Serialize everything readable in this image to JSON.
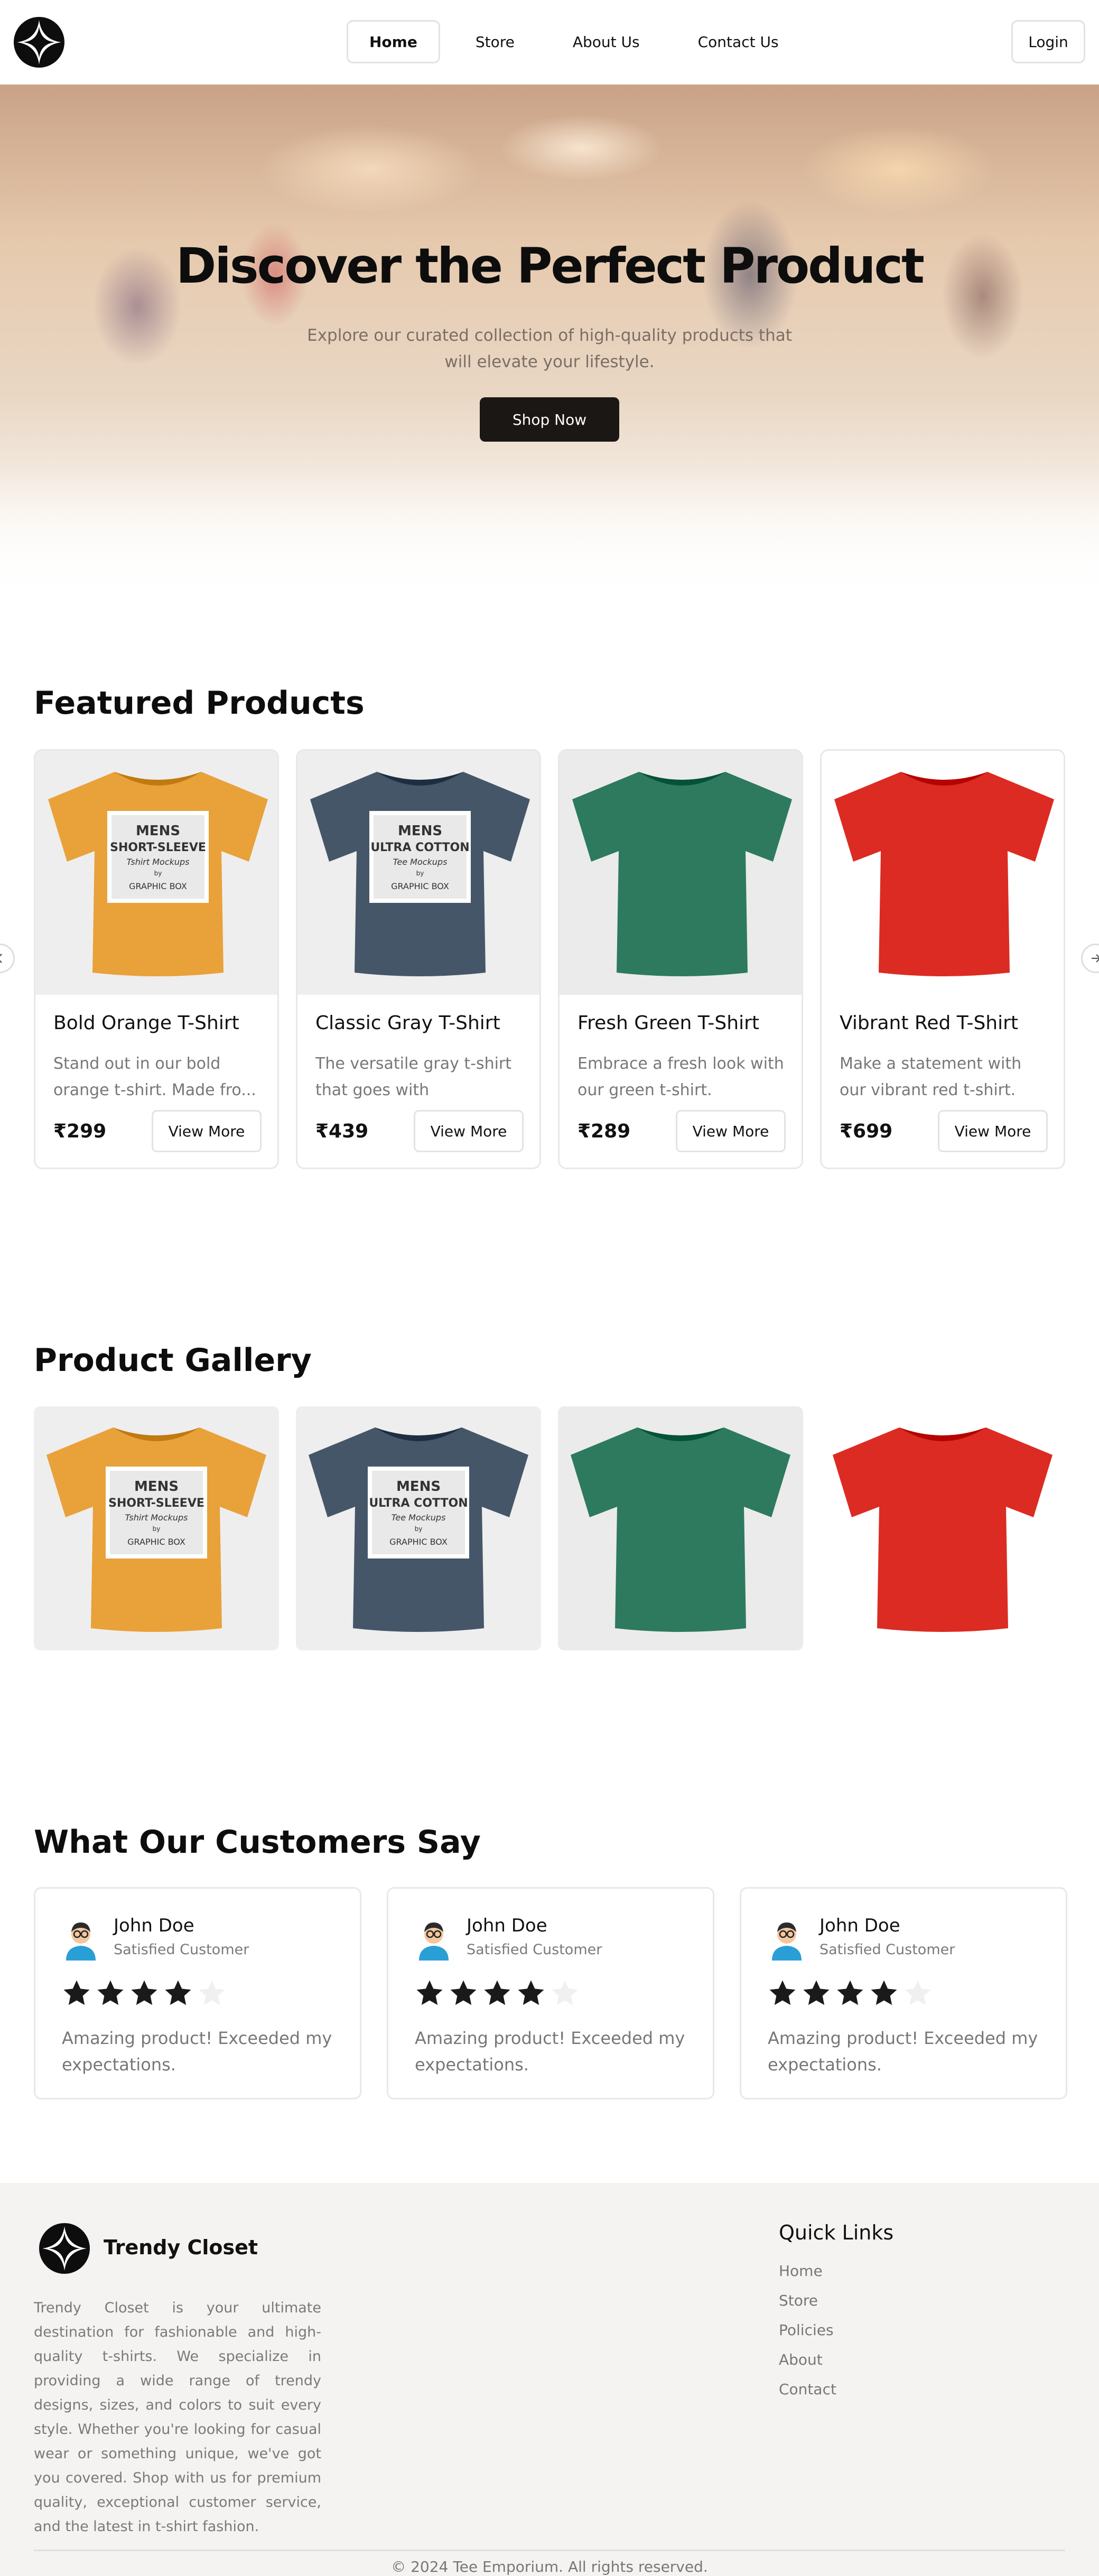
{
  "nav": {
    "links": [
      "Home",
      "Store",
      "About Us",
      "Contact Us"
    ],
    "active": "Home",
    "login": "Login"
  },
  "hero": {
    "title": "Discover the Perfect Product",
    "subtitle": "Explore our curated collection of high-quality products that will elevate your lifestyle.",
    "cta": "Shop Now"
  },
  "featured": {
    "title": "Featured Products",
    "products": [
      {
        "name": "Bold Orange T-Shirt",
        "desc": "Stand out in our bold orange t-shirt. Made fro...",
        "price": "₹299",
        "button": "View More",
        "shirt_color": "#e9a13a",
        "shirt_text": [
          "MENS",
          "SHORT-SLEEVE",
          "Tshirt Mockups",
          "by",
          "GRAPHIC BOX"
        ]
      },
      {
        "name": "Classic Gray T-Shirt",
        "desc": "The versatile gray t-shirt that goes with everything...",
        "price": "₹439",
        "button": "View More",
        "shirt_color": "#455669",
        "shirt_text": [
          "MENS",
          "ULTRA COTTON",
          "Tee Mockups",
          "by",
          "GRAPHIC BOX"
        ]
      },
      {
        "name": "Fresh Green T-Shirt",
        "desc": "Embrace a fresh look with our green t-shirt. Crafted...",
        "price": "₹289",
        "button": "View More",
        "shirt_color": "#2d7a5f",
        "shirt_text": []
      },
      {
        "name": "Vibrant Red T-Shirt",
        "desc": "Make a statement with our vibrant red t-shirt. Made...",
        "price": "₹699",
        "button": "View More",
        "shirt_color": "#dc2b22",
        "shirt_text": []
      }
    ]
  },
  "gallery": {
    "title": "Product Gallery"
  },
  "testimonials": {
    "title": "What Our Customers Say",
    "items": [
      {
        "name": "John Doe",
        "role": "Satisfied Customer",
        "rating": 4,
        "text": "Amazing product! Exceeded my expectations."
      },
      {
        "name": "John Doe",
        "role": "Satisfied Customer",
        "rating": 4,
        "text": "Amazing product! Exceeded my expectations."
      },
      {
        "name": "John Doe",
        "role": "Satisfied Customer",
        "rating": 4,
        "text": "Amazing product! Exceeded my expectations."
      }
    ]
  },
  "footer": {
    "brand": "Trendy Closet",
    "about": "Trendy Closet is your ultimate destination for fashionable and high-quality t-shirts. We specialize in providing a wide range of trendy designs, sizes, and colors to suit every style. Whether you're looking for casual wear or something unique, we've got you covered. Shop with us for premium quality, exceptional customer service, and the latest in t-shirt fashion.",
    "quick_links_title": "Quick Links",
    "quick_links": [
      "Home",
      "Store",
      "Policies",
      "About",
      "Contact"
    ],
    "copyright": "© 2024 Tee Emporium. All rights reserved."
  },
  "icons": {
    "logo": "four-point-star-logo-icon",
    "prev": "chevron-left-icon",
    "next": "chevron-right-icon",
    "star": "star-icon",
    "avatar": "user-avatar-icon"
  }
}
